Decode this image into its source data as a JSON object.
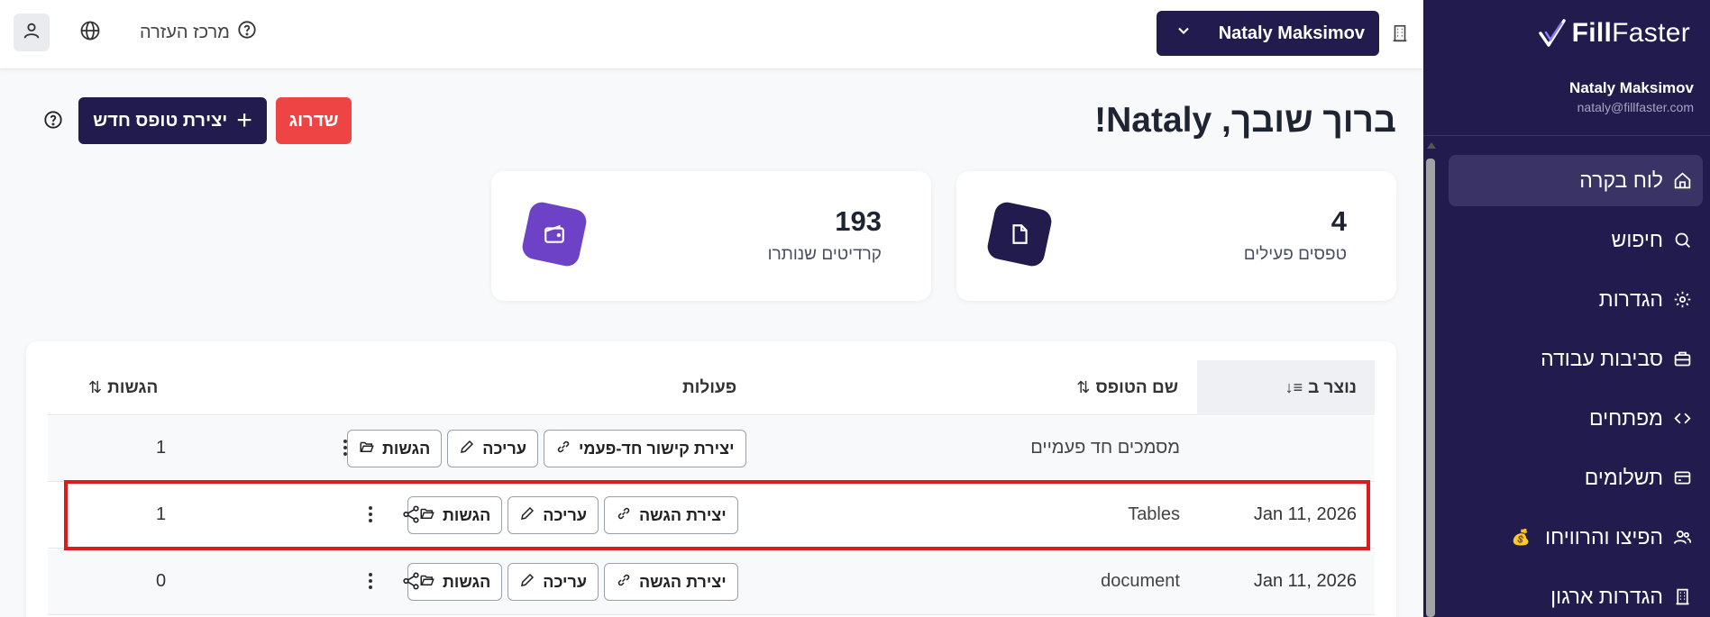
{
  "sidebar": {
    "brand_fill": "Fill",
    "brand_faster": "Faster",
    "user_name": "Nataly Maksimov",
    "user_email": "nataly@fillfaster.com",
    "items": [
      {
        "label": "לוח בקרה",
        "icon": "home-icon",
        "active": true
      },
      {
        "label": "חיפוש",
        "icon": "search-icon"
      },
      {
        "label": "הגדרות",
        "icon": "gear-icon"
      },
      {
        "label": "סביבות עבודה",
        "icon": "briefcase-icon"
      },
      {
        "label": "מפתחים",
        "icon": "code-icon"
      },
      {
        "label": "תשלומים",
        "icon": "credit-card-icon"
      },
      {
        "label": "הפיצו והרוויחו",
        "icon": "users-icon",
        "emoji": "💰"
      },
      {
        "label": "הגדרות ארגון",
        "icon": "building-icon"
      }
    ]
  },
  "topbar": {
    "user_switch": "Nataly Maksimov",
    "help_label": "מרכז העזרה"
  },
  "header": {
    "welcome": "ברוך שובך, Nataly!",
    "upgrade": "שדרוג",
    "create": "יצירת טופס חדש"
  },
  "stats": {
    "active_forms_value": "4",
    "active_forms_label": "טפסים פעילים",
    "credits_value": "193",
    "credits_label": "קרדיטים שנותרו"
  },
  "table": {
    "headers": {
      "created": "נוצר ב",
      "name": "שם הטופס",
      "actions": "פעולות",
      "submissions": "הגשות"
    },
    "rows": [
      {
        "date": "",
        "name": "מסמכים חד פעמיים",
        "primary": "יצירת קישור חד-פעמי",
        "edit": "עריכה",
        "subs_btn": "הגשות",
        "count": "1"
      },
      {
        "date": "Jan 11, 2026",
        "name": "Tables",
        "primary": "יצירת הגשה",
        "edit": "עריכה",
        "subs_btn": "הגשות",
        "count": "1"
      },
      {
        "date": "Jan 11, 2026",
        "name": "document",
        "primary": "יצירת הגשה",
        "edit": "עריכה",
        "subs_btn": "הגשות",
        "count": "0"
      }
    ]
  },
  "colors": {
    "navy": "#221b4d",
    "upgrade_red": "#ef4444",
    "purple": "#6d42c6",
    "highlight_red": "#dc1c1c"
  }
}
